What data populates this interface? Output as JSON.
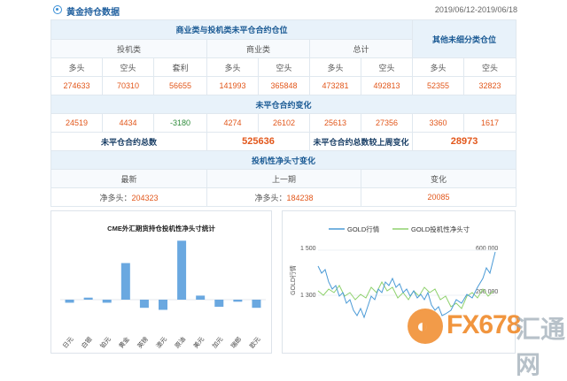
{
  "header": {
    "icon": "circle-dot-icon",
    "title": "黄金持仓数据",
    "date_range": "2019/06/12-2019/06/18"
  },
  "table": {
    "group_title": "商业类与投机类未平仓合约仓位",
    "other_title": "其他未细分类仓位",
    "sub_groups": [
      "投机类",
      "商业类",
      "总计"
    ],
    "col_labels": [
      "多头",
      "空头",
      "套利",
      "多头",
      "空头",
      "多头",
      "空头",
      "多头",
      "空头"
    ],
    "positions": [
      "274633",
      "70310",
      "56655",
      "141993",
      "365848",
      "473281",
      "492813",
      "52355",
      "32823"
    ],
    "change_title": "未平仓合约变化",
    "changes": [
      "24519",
      "4434",
      "-3180",
      "4274",
      "26102",
      "25613",
      "27356",
      "3360",
      "1617"
    ],
    "total_label": "未平仓合约总数",
    "total_value": "525636",
    "weekly_change_label": "未平仓合约总数较上周变化",
    "weekly_change_value": "28973",
    "net_title": "投机性净头寸变化",
    "net_headers": [
      "最新",
      "上一期",
      "变化"
    ],
    "net_prefix": "净多头：",
    "net_latest": "204323",
    "net_previous": "184238",
    "net_change": "20085"
  },
  "chart_data": [
    {
      "type": "bar",
      "title": "CME外汇期货持仓投机性净头寸统计",
      "categories": [
        "日元",
        "白银",
        "铂元",
        "黄金",
        "英镑",
        "澳元",
        "原油",
        "美元",
        "加元",
        "瑞郎",
        "欧元"
      ],
      "values": [
        -3,
        2,
        -3,
        36,
        -8,
        -10,
        58,
        4,
        -7,
        -2,
        -8
      ],
      "color": "#6aa8e0"
    },
    {
      "type": "line",
      "series": [
        {
          "name": "GOLD行情",
          "color": "#4a9ad6"
        },
        {
          "name": "GOLD投机性净头寸",
          "color": "#8fd16e"
        }
      ],
      "ylabel": "GOLD行情",
      "left_ticks": [
        "1 500",
        "1 300"
      ],
      "right_ticks": [
        "600 000",
        "200 000"
      ]
    }
  ],
  "watermark": {
    "brand": "FX678",
    "cn": "汇通网"
  }
}
